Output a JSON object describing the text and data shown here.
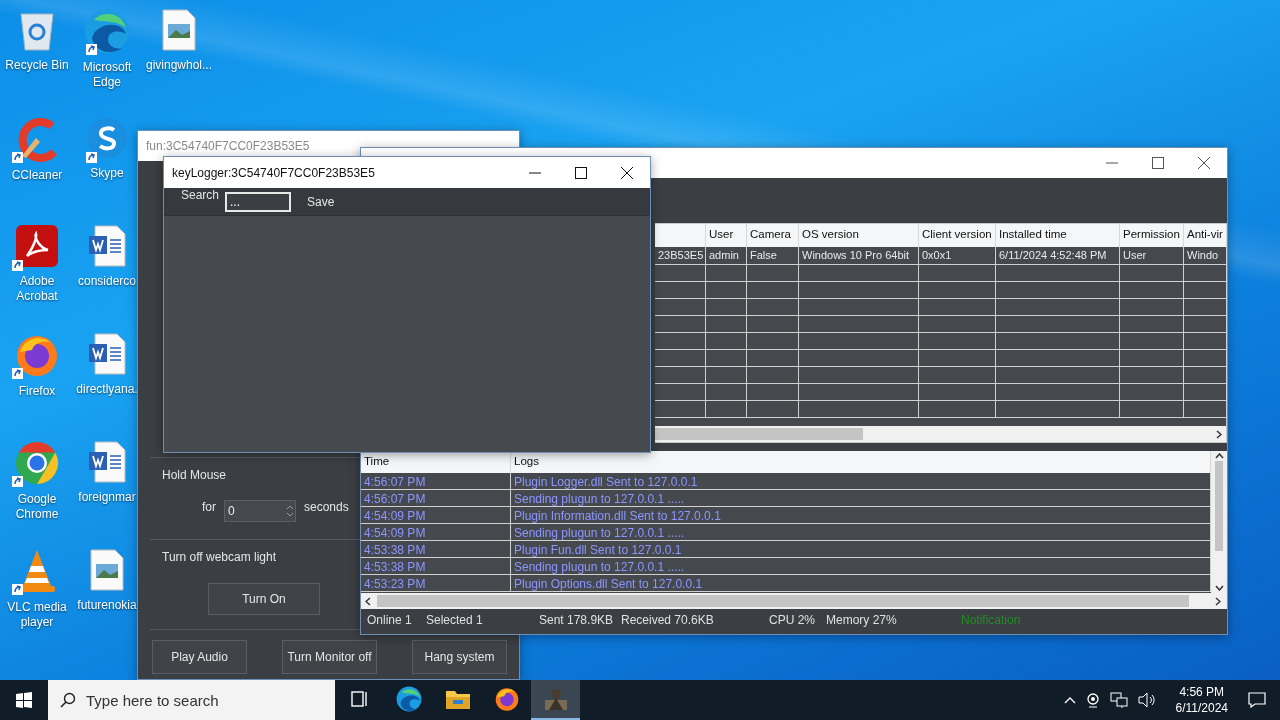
{
  "desktop_icons": [
    {
      "label": "Recycle Bin",
      "kind": "recycle",
      "shortcut": false
    },
    {
      "label": "Microsoft Edge",
      "kind": "edge",
      "shortcut": true
    },
    {
      "label": "givingwhol...",
      "kind": "image",
      "shortcut": false
    },
    {
      "label": "CCleaner",
      "kind": "ccleaner",
      "shortcut": true
    },
    {
      "label": "Skype",
      "kind": "skype",
      "shortcut": true
    },
    {
      "label": "Adobe Acrobat",
      "kind": "acrobat",
      "shortcut": true
    },
    {
      "label": "considerco",
      "kind": "word",
      "shortcut": false
    },
    {
      "label": "Firefox",
      "kind": "firefox",
      "shortcut": true
    },
    {
      "label": "directlyana.",
      "kind": "word",
      "shortcut": false
    },
    {
      "label": "Google Chrome",
      "kind": "chrome",
      "shortcut": true
    },
    {
      "label": "foreignmar",
      "kind": "word",
      "shortcut": false
    },
    {
      "label": "VLC media player",
      "kind": "vlc",
      "shortcut": true
    },
    {
      "label": "futurenokia",
      "kind": "image",
      "shortcut": false
    }
  ],
  "fun_window": {
    "title": "fun:3C54740F7CC0F23B53E5",
    "hold_mouse": {
      "title": "Hold Mouse",
      "for_label": "for",
      "value": "0",
      "unit": "seconds"
    },
    "webcam": {
      "title": "Turn off webcam light",
      "button": "Turn On"
    },
    "buttons": [
      "Play Audio",
      "Turn Monitor off",
      "Hang system"
    ]
  },
  "main_window": {
    "clients_table": {
      "columns": [
        "User",
        "Camera",
        "OS version",
        "Client version",
        "Installed time",
        "Permission",
        "Anti-vir"
      ],
      "rows": [
        {
          "column_1": "23B53E5",
          "cells": [
            "admin",
            "False",
            "Windows 10 Pro 64bit",
            "0x0x1",
            "6/11/2024 4:52:48 PM",
            "User",
            "Windo"
          ]
        }
      ]
    },
    "logs": {
      "columns": [
        "Time",
        "Logs"
      ],
      "rows": [
        {
          "time": "4:56:07 PM",
          "message": "Plugin Logger.dll Sent to 127.0.0.1"
        },
        {
          "time": "4:56:07 PM",
          "message": "Sending plugun to 127.0.0.1 ....."
        },
        {
          "time": "4:54:09 PM",
          "message": "Plugin Information.dll Sent to 127.0.0.1"
        },
        {
          "time": "4:54:09 PM",
          "message": "Sending plugun to 127.0.0.1 ....."
        },
        {
          "time": "4:53:38 PM",
          "message": "Plugin Fun.dll Sent to 127.0.0.1"
        },
        {
          "time": "4:53:38 PM",
          "message": "Sending plugun to 127.0.0.1 ....."
        },
        {
          "time": "4:53:23 PM",
          "message": "Plugin Options.dll Sent to 127.0.0.1"
        }
      ]
    },
    "status_bar": [
      {
        "text": "Online 1",
        "kind": "info"
      },
      {
        "text": "Selected 1",
        "kind": "info"
      },
      {
        "text": "Sent 178.9KB",
        "kind": "info"
      },
      {
        "text": "Received  70.6KB",
        "kind": "info"
      },
      {
        "text": "CPU 2%",
        "kind": "info"
      },
      {
        "text": "Memory 27%",
        "kind": "info"
      },
      {
        "text": "Notification",
        "kind": "notice"
      }
    ]
  },
  "keylogger_window": {
    "title": "keyLogger:3C54740F7CC0F23B53E5",
    "search_label": "Search",
    "search_value": "...",
    "save": "Save"
  },
  "taskbar": {
    "search_placeholder": "Type here to search",
    "apps": [
      {
        "kind": "taskview",
        "selected": false
      },
      {
        "kind": "edge",
        "selected": false
      },
      {
        "kind": "explorer",
        "selected": false
      },
      {
        "kind": "firefox",
        "selected": false
      },
      {
        "kind": "app",
        "selected": true
      }
    ],
    "time": "4:56 PM",
    "date": "6/11/2024"
  }
}
